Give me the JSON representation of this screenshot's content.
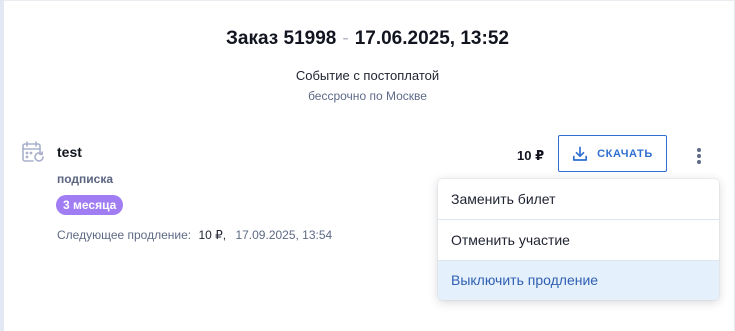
{
  "order": {
    "title": "Заказ 51998",
    "separator": "-",
    "datetime": "17.06.2025, 13:52"
  },
  "event": {
    "name": "Событие с постоплатой",
    "subtitle": "бессрочно по Москве"
  },
  "ticket": {
    "icon": "calendar-refresh-icon",
    "name": "test",
    "type": "подписка",
    "badge": "3 месяца",
    "renewal_label": "Следующее продление:",
    "renewal_price": "10 ₽,",
    "renewal_date": "17.09.2025, 13:54",
    "price": "10 ₽"
  },
  "actions": {
    "download_label": "СКАЧАТЬ",
    "download_icon": "download-icon",
    "more_icon": "more-vertical-icon"
  },
  "menu": {
    "items": [
      {
        "label": "Заменить билет"
      },
      {
        "label": "Отменить участие"
      },
      {
        "label": "Выключить продление",
        "highlighted": true
      }
    ]
  },
  "colors": {
    "accent": "#2f6fd1",
    "badge": "#a07df2",
    "menu_highlight": "#e4f0fc"
  }
}
